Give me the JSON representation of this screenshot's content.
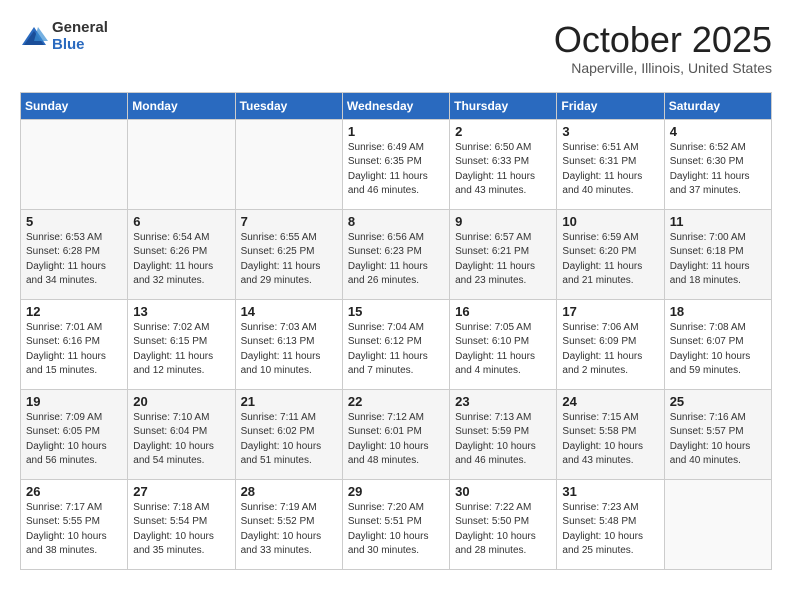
{
  "logo": {
    "general": "General",
    "blue": "Blue"
  },
  "title": "October 2025",
  "location": "Naperville, Illinois, United States",
  "headers": [
    "Sunday",
    "Monday",
    "Tuesday",
    "Wednesday",
    "Thursday",
    "Friday",
    "Saturday"
  ],
  "weeks": [
    [
      {
        "day": "",
        "info": ""
      },
      {
        "day": "",
        "info": ""
      },
      {
        "day": "",
        "info": ""
      },
      {
        "day": "1",
        "info": "Sunrise: 6:49 AM\nSunset: 6:35 PM\nDaylight: 11 hours and 46 minutes."
      },
      {
        "day": "2",
        "info": "Sunrise: 6:50 AM\nSunset: 6:33 PM\nDaylight: 11 hours and 43 minutes."
      },
      {
        "day": "3",
        "info": "Sunrise: 6:51 AM\nSunset: 6:31 PM\nDaylight: 11 hours and 40 minutes."
      },
      {
        "day": "4",
        "info": "Sunrise: 6:52 AM\nSunset: 6:30 PM\nDaylight: 11 hours and 37 minutes."
      }
    ],
    [
      {
        "day": "5",
        "info": "Sunrise: 6:53 AM\nSunset: 6:28 PM\nDaylight: 11 hours and 34 minutes."
      },
      {
        "day": "6",
        "info": "Sunrise: 6:54 AM\nSunset: 6:26 PM\nDaylight: 11 hours and 32 minutes."
      },
      {
        "day": "7",
        "info": "Sunrise: 6:55 AM\nSunset: 6:25 PM\nDaylight: 11 hours and 29 minutes."
      },
      {
        "day": "8",
        "info": "Sunrise: 6:56 AM\nSunset: 6:23 PM\nDaylight: 11 hours and 26 minutes."
      },
      {
        "day": "9",
        "info": "Sunrise: 6:57 AM\nSunset: 6:21 PM\nDaylight: 11 hours and 23 minutes."
      },
      {
        "day": "10",
        "info": "Sunrise: 6:59 AM\nSunset: 6:20 PM\nDaylight: 11 hours and 21 minutes."
      },
      {
        "day": "11",
        "info": "Sunrise: 7:00 AM\nSunset: 6:18 PM\nDaylight: 11 hours and 18 minutes."
      }
    ],
    [
      {
        "day": "12",
        "info": "Sunrise: 7:01 AM\nSunset: 6:16 PM\nDaylight: 11 hours and 15 minutes."
      },
      {
        "day": "13",
        "info": "Sunrise: 7:02 AM\nSunset: 6:15 PM\nDaylight: 11 hours and 12 minutes."
      },
      {
        "day": "14",
        "info": "Sunrise: 7:03 AM\nSunset: 6:13 PM\nDaylight: 11 hours and 10 minutes."
      },
      {
        "day": "15",
        "info": "Sunrise: 7:04 AM\nSunset: 6:12 PM\nDaylight: 11 hours and 7 minutes."
      },
      {
        "day": "16",
        "info": "Sunrise: 7:05 AM\nSunset: 6:10 PM\nDaylight: 11 hours and 4 minutes."
      },
      {
        "day": "17",
        "info": "Sunrise: 7:06 AM\nSunset: 6:09 PM\nDaylight: 11 hours and 2 minutes."
      },
      {
        "day": "18",
        "info": "Sunrise: 7:08 AM\nSunset: 6:07 PM\nDaylight: 10 hours and 59 minutes."
      }
    ],
    [
      {
        "day": "19",
        "info": "Sunrise: 7:09 AM\nSunset: 6:05 PM\nDaylight: 10 hours and 56 minutes."
      },
      {
        "day": "20",
        "info": "Sunrise: 7:10 AM\nSunset: 6:04 PM\nDaylight: 10 hours and 54 minutes."
      },
      {
        "day": "21",
        "info": "Sunrise: 7:11 AM\nSunset: 6:02 PM\nDaylight: 10 hours and 51 minutes."
      },
      {
        "day": "22",
        "info": "Sunrise: 7:12 AM\nSunset: 6:01 PM\nDaylight: 10 hours and 48 minutes."
      },
      {
        "day": "23",
        "info": "Sunrise: 7:13 AM\nSunset: 5:59 PM\nDaylight: 10 hours and 46 minutes."
      },
      {
        "day": "24",
        "info": "Sunrise: 7:15 AM\nSunset: 5:58 PM\nDaylight: 10 hours and 43 minutes."
      },
      {
        "day": "25",
        "info": "Sunrise: 7:16 AM\nSunset: 5:57 PM\nDaylight: 10 hours and 40 minutes."
      }
    ],
    [
      {
        "day": "26",
        "info": "Sunrise: 7:17 AM\nSunset: 5:55 PM\nDaylight: 10 hours and 38 minutes."
      },
      {
        "day": "27",
        "info": "Sunrise: 7:18 AM\nSunset: 5:54 PM\nDaylight: 10 hours and 35 minutes."
      },
      {
        "day": "28",
        "info": "Sunrise: 7:19 AM\nSunset: 5:52 PM\nDaylight: 10 hours and 33 minutes."
      },
      {
        "day": "29",
        "info": "Sunrise: 7:20 AM\nSunset: 5:51 PM\nDaylight: 10 hours and 30 minutes."
      },
      {
        "day": "30",
        "info": "Sunrise: 7:22 AM\nSunset: 5:50 PM\nDaylight: 10 hours and 28 minutes."
      },
      {
        "day": "31",
        "info": "Sunrise: 7:23 AM\nSunset: 5:48 PM\nDaylight: 10 hours and 25 minutes."
      },
      {
        "day": "",
        "info": ""
      }
    ]
  ]
}
